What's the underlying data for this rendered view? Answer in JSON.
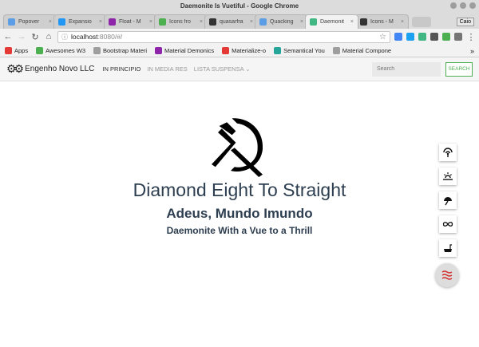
{
  "window": {
    "title": "Daemonite Is Vuetiful - Google Chrome"
  },
  "tabs": [
    {
      "label": "Popover",
      "color": "#5c9ee6",
      "active": false
    },
    {
      "label": "Expansio",
      "color": "#2196f3",
      "active": false
    },
    {
      "label": "Float - M",
      "color": "#8e24aa",
      "active": false
    },
    {
      "label": "Icons fro",
      "color": "#4caf50",
      "active": false
    },
    {
      "label": "quasarfra",
      "color": "#333333",
      "active": false
    },
    {
      "label": "Quacking",
      "color": "#5c9ee6",
      "active": false
    },
    {
      "label": "Daemonit",
      "color": "#41b883",
      "active": true
    },
    {
      "label": "Icons - M",
      "color": "#333333",
      "active": false
    }
  ],
  "profile": "Caio",
  "toolbar": {
    "url_host": "localhost",
    "url_path": ":8080/#/"
  },
  "bookmarks": [
    {
      "label": "Apps",
      "color": "#e53935"
    },
    {
      "label": "Awesomes W3",
      "color": "#4caf50"
    },
    {
      "label": "Bootstrap Materi",
      "color": "#9e9e9e"
    },
    {
      "label": "Material Demonics",
      "color": "#8e24aa"
    },
    {
      "label": "Materialize-o",
      "color": "#e53935"
    },
    {
      "label": "Semantical You",
      "color": "#26a69a"
    },
    {
      "label": "Material Compone",
      "color": "#9e9e9e"
    }
  ],
  "bookmarks_more": "»",
  "app": {
    "brand": "Engenho Novo LLC",
    "nav": [
      "IN PRINCIPIO",
      "IN MEDIA RES",
      "LISTA SUSPENSA"
    ],
    "search_placeholder": "Search",
    "search_button": "SEARCH"
  },
  "hero": {
    "title": "Diamond Eight To Straight",
    "subtitle": "Adeus, Mundo Imundo",
    "tagline": "Daemonite With a Vue to a Thrill"
  },
  "fabs": [
    "signal-icon",
    "sunset-icon",
    "umbrella-icon",
    "infinity-icon",
    "bathtub-icon"
  ],
  "fab_main_icon": "waves-icon"
}
